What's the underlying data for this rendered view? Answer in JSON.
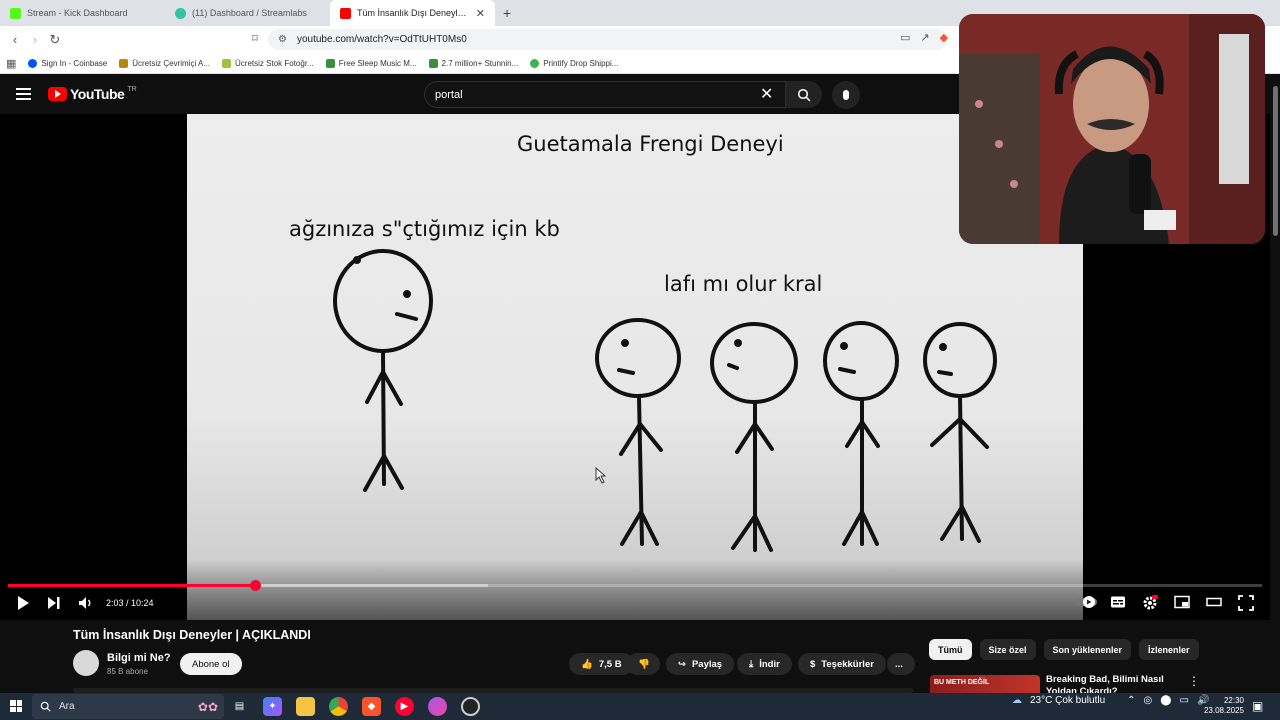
{
  "browser": {
    "tabs": [
      {
        "title": "Stream - Kick Dashboard",
        "favicon_color": "#53fc18",
        "active": false
      },
      {
        "title": "(11) Dashboard / Streamlabs",
        "favicon_color": "#31c3a2",
        "active": false
      },
      {
        "title": "Tüm İnsanlık Dışı Deneyler | AÇIK",
        "favicon_color": "#ff0000",
        "active": true
      }
    ],
    "url": "youtube.com/watch?v=OdTtUHT0Ms0",
    "bookmarks": [
      {
        "label": "Sign In - Coinbase",
        "color": "#0052ff"
      },
      {
        "label": "Ücretsiz Çevrimiçi A...",
        "color": "#b8860b"
      },
      {
        "label": "Ücretsiz Stok Fotoğr...",
        "color": "#9bc53d"
      },
      {
        "label": "Free Sleep Music M...",
        "color": "#3a8f3a"
      },
      {
        "label": "2.7 million+ Stunnin...",
        "color": "#3a8f3a"
      },
      {
        "label": "Printify Drop Shippi...",
        "color": "#39b54a"
      }
    ]
  },
  "youtube": {
    "logo": "YouTube",
    "region": "TR",
    "search_query": "portal"
  },
  "video_frame": {
    "title_text": "Guetamala Frengi Deneyi",
    "left_caption": "ağzınıza s\"çtığımız için kb",
    "right_caption": "lafı mı olur kral"
  },
  "player": {
    "time": "2:03 / 10:24",
    "played_fraction": 0.197,
    "buffered_fraction": 0.383
  },
  "video": {
    "title": "Tüm İnsanlık Dışı Deneyler | AÇIKLANDI",
    "channel": "Bilgi mi Ne?",
    "subscribers": "85 B abone",
    "subscribe_label": "Abone ol",
    "likes": "7,5 B",
    "share_label": "Paylaş",
    "download_label": "İndir",
    "thanks_label": "Teşekkürler",
    "more_label": "..."
  },
  "sidebar": {
    "chips": [
      "Tümü",
      "Size özel",
      "Son yüklenenler",
      "İzlenenler"
    ],
    "rec_thumb_text": "BU METH DEĞİL",
    "rec_title": "Breaking Bad, Bilimi Nasıl Yoldan Çıkardı?"
  },
  "taskbar": {
    "search_placeholder": "Ara",
    "weather": "23°C  Çok bulutlu",
    "time": "22:30",
    "date": "23.08.2025"
  }
}
